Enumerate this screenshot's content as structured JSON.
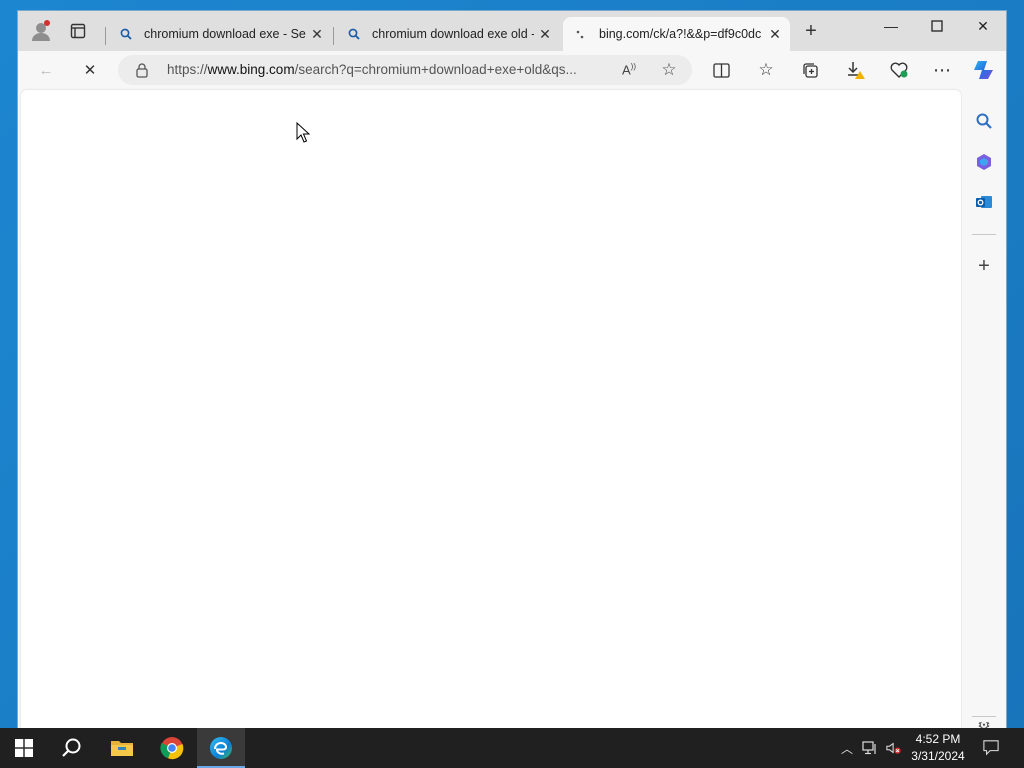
{
  "tabs": [
    {
      "title": "chromium download exe - Sea",
      "icon": "search-icon"
    },
    {
      "title": "chromium download exe old -",
      "icon": "search-icon"
    },
    {
      "title": "bing.com/ck/a?!&&p=df9c0dc",
      "icon": "loading-icon",
      "active": true
    }
  ],
  "address_bar": {
    "url_prefix": "https://",
    "url_host": "www.bing.com",
    "url_rest": "/search?q=chromium+download+exe+old&qs..."
  },
  "taskbar": {
    "time": "4:52 PM",
    "date": "3/31/2024",
    "apps": [
      "start-icon",
      "search-icon",
      "file-explorer-icon",
      "chrome-icon",
      "edge-icon"
    ]
  },
  "colors": {
    "accent": "#1a5aa8",
    "download_warning": "#f2b300",
    "profile_dot": "#d32f2f"
  }
}
